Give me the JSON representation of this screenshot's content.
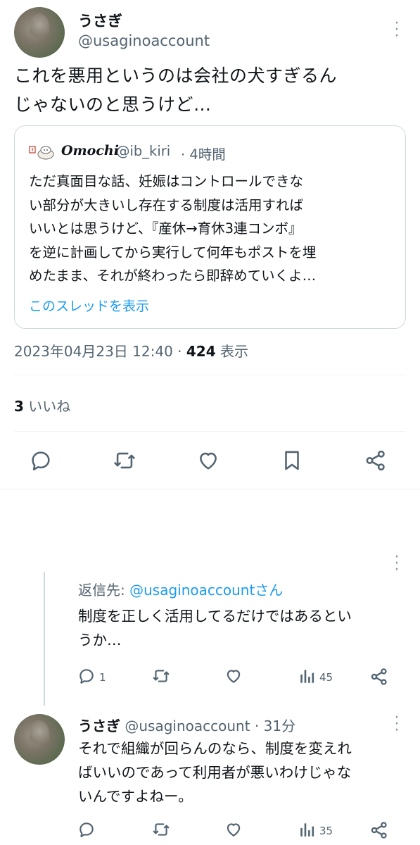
{
  "main_tweet": {
    "author_name": "うさぎ",
    "author_handle": "@usaginoaccount",
    "text_lines": [
      "これを悪用というのは会社の犬すぎるん",
      "じゃないのと思うけど…"
    ],
    "quote": {
      "author_name": "Omochi",
      "author_handle": "@ib_kiri",
      "time": "· 4時間",
      "text_lines": [
        "ただ真面目な話、妊娠はコントロールできな",
        "い部分が大きいし存在する制度は活用すれば",
        "いいとは思うけど、『産休→育休3連コンボ』",
        "を逆に計画してから実行して何年もポストを埋",
        "めたまま、それが終わったら即辞めていくよ…"
      ],
      "show_thread": "このスレッドを表示"
    },
    "timestamp": "2023年04月23日 12:40",
    "views_count": "424",
    "views_label": "表示",
    "likes_count": "3",
    "likes_label": "いいね"
  },
  "reply_1": {
    "reply_to_prefix": "返信先: ",
    "reply_to_handle": "@usaginoaccountさん",
    "text_lines": [
      "制度を正しく活用してるだけではあるとい",
      "うか…"
    ],
    "reply_count": "1",
    "view_count": "45"
  },
  "reply_2": {
    "author_name": "うさぎ",
    "author_handle": "@usaginoaccount",
    "time": "· 31分",
    "text_lines": [
      "それで組織が回らんのなら、制度を変えれ",
      "ばいいのであって利用者が悪いわけじゃな",
      "いんですよねー。"
    ],
    "view_count": "35"
  },
  "colors": {
    "text": "#0f1419",
    "secondary": "#536471",
    "link": "#1d9bf0",
    "border": "#cfd9de"
  }
}
